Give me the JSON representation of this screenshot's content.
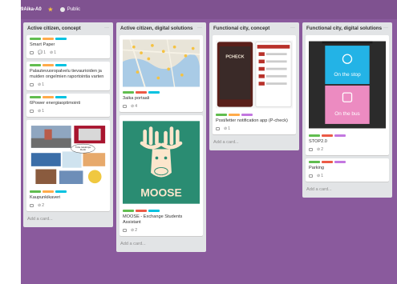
{
  "topbar": {
    "fragment": "s",
    "board_name": "9Aika-A0",
    "visibility": "Public"
  },
  "colors": {
    "green": "#61bd4f",
    "orange": "#ffab4a",
    "blue": "#00c2e0",
    "red": "#eb5a46",
    "purple": "#c377e0",
    "board": "#8a5a9d"
  },
  "lists": [
    {
      "title": "Active citizen, concept",
      "add_card": "Add a card...",
      "cards": [
        {
          "title": "Smart Paper",
          "desc": "",
          "comments": "1",
          "attach": "1"
        },
        {
          "title": "Palautevuoropalvelu tievaurioiden ja muiden ongelmien raportointia varten",
          "attach": "1"
        },
        {
          "title": "6Power energiaoptimointi",
          "attach": "1"
        },
        {
          "title": "Kaupunkikaveri",
          "attach": "2",
          "speech1": "Tolle liekkiinja",
          "speech2": "Reitti"
        }
      ]
    },
    {
      "title": "Active citizen, digital solutions",
      "add_card": "Add a card...",
      "cards": [
        {
          "title": "3aika portaali",
          "attach": "4"
        },
        {
          "title": "MOOSE - Exchange Students Assistant",
          "attach": "2",
          "cover_text": "MOOSE"
        }
      ]
    },
    {
      "title": "Functional city, concept",
      "add_card": "Add a card...",
      "cards": [
        {
          "title": "Post/letter notification app (P-check)",
          "attach": "1",
          "cover_text": "PCHECK"
        }
      ]
    },
    {
      "title": "Functional city, digital solutions",
      "add_card": "Add a card...",
      "cards": [
        {
          "title": "STOP2.0",
          "attach": "2",
          "panel1": "On the stop",
          "panel2": "On the bus"
        },
        {
          "title": "Parking",
          "attach": "1"
        }
      ]
    }
  ]
}
